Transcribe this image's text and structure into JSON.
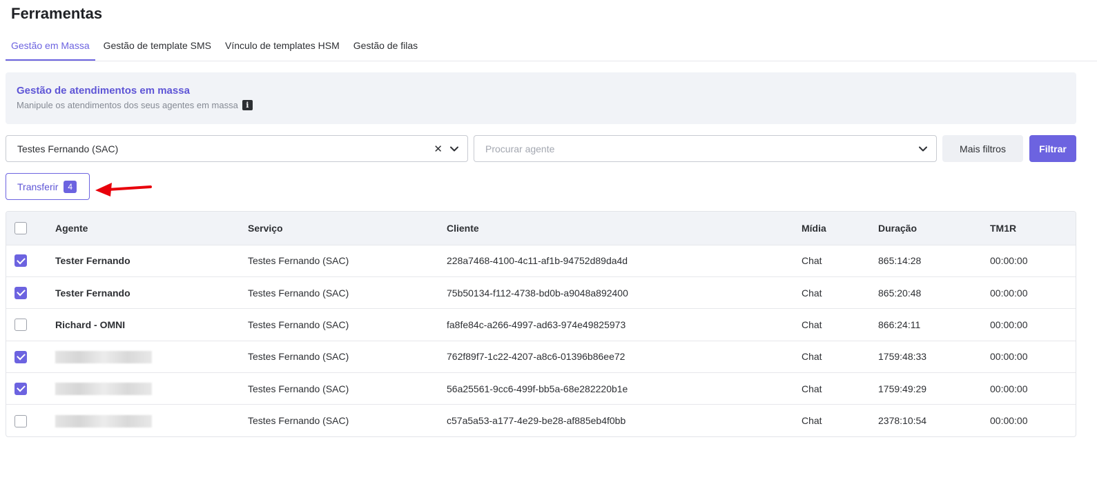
{
  "page": {
    "title": "Ferramentas"
  },
  "tabs": [
    {
      "label": "Gestão em Massa",
      "active": true
    },
    {
      "label": "Gestão de template SMS",
      "active": false
    },
    {
      "label": "Vínculo de templates HSM",
      "active": false
    },
    {
      "label": "Gestão de filas",
      "active": false
    }
  ],
  "banner": {
    "title": "Gestão de atendimentos em massa",
    "subtitle": "Manipule os atendimentos dos seus agentes em massa",
    "info_icon": "info-icon"
  },
  "filters": {
    "service_select": {
      "value": "Testes Fernando (SAC)",
      "clear_icon": "close-icon",
      "dropdown_icon": "chevron-down-icon"
    },
    "agent_select": {
      "placeholder": "Procurar agente",
      "dropdown_icon": "chevron-down-icon"
    },
    "more_filters_label": "Mais filtros",
    "filter_label": "Filtrar"
  },
  "transfer": {
    "label": "Transferir",
    "count": "4"
  },
  "colors": {
    "accent": "#6c63e0",
    "annotation_arrow": "#e8000b"
  },
  "table": {
    "headers": [
      "Agente",
      "Serviço",
      "Cliente",
      "Mídia",
      "Duração",
      "TM1R"
    ],
    "rows": [
      {
        "checked": true,
        "agent": "Tester Fernando",
        "agent_redacted": false,
        "service": "Testes Fernando (SAC)",
        "client": "228a7468-4100-4c11-af1b-94752d89da4d",
        "media": "Chat",
        "duration": "865:14:28",
        "tm1r": "00:00:00"
      },
      {
        "checked": true,
        "agent": "Tester Fernando",
        "agent_redacted": false,
        "service": "Testes Fernando (SAC)",
        "client": "75b50134-f112-4738-bd0b-a9048a892400",
        "media": "Chat",
        "duration": "865:20:48",
        "tm1r": "00:00:00"
      },
      {
        "checked": false,
        "agent": "Richard - OMNI",
        "agent_redacted": false,
        "service": "Testes Fernando (SAC)",
        "client": "fa8fe84c-a266-4997-ad63-974e49825973",
        "media": "Chat",
        "duration": "866:24:11",
        "tm1r": "00:00:00"
      },
      {
        "checked": true,
        "agent": "",
        "agent_redacted": true,
        "service": "Testes Fernando (SAC)",
        "client": "762f89f7-1c22-4207-a8c6-01396b86ee72",
        "media": "Chat",
        "duration": "1759:48:33",
        "tm1r": "00:00:00"
      },
      {
        "checked": true,
        "agent": "",
        "agent_redacted": true,
        "service": "Testes Fernando (SAC)",
        "client": "56a25561-9cc6-499f-bb5a-68e282220b1e",
        "media": "Chat",
        "duration": "1759:49:29",
        "tm1r": "00:00:00"
      },
      {
        "checked": false,
        "agent": "",
        "agent_redacted": true,
        "service": "Testes Fernando (SAC)",
        "client": "c57a5a53-a177-4e29-be28-af885eb4f0bb",
        "media": "Chat",
        "duration": "2378:10:54",
        "tm1r": "00:00:00"
      }
    ]
  }
}
